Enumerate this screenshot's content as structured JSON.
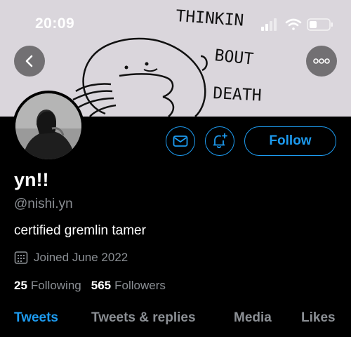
{
  "status_bar": {
    "time": "20:09"
  },
  "banner": {
    "doodle_text": [
      "THINKIN",
      "BOUT",
      "DEATH"
    ]
  },
  "profile": {
    "display_name": "yn!!",
    "handle": "@nishi.yn",
    "bio": "certified gremlin tamer",
    "joined": "Joined June 2022",
    "following_count": "25",
    "following_label": "Following",
    "followers_count": "565",
    "followers_label": "Followers"
  },
  "actions": {
    "follow_label": "Follow"
  },
  "tabs": [
    {
      "label": "Tweets"
    },
    {
      "label": "Tweets & replies"
    },
    {
      "label": "Media"
    },
    {
      "label": "Likes"
    }
  ],
  "colors": {
    "accent": "#1d9bf0",
    "muted": "#8b8f94",
    "background": "#000000"
  }
}
